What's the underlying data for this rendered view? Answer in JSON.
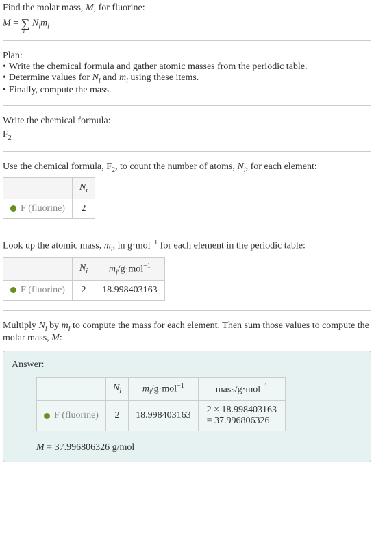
{
  "intro": {
    "line1_pre": "Find the molar mass, ",
    "line1_var": "M",
    "line1_post": ", for fluorine:",
    "formula_lhs": "M",
    "formula_eq": " = ",
    "formula_sum": "∑",
    "formula_sub": "i",
    "formula_n": "N",
    "formula_ni": "i",
    "formula_m": "m",
    "formula_mi": "i"
  },
  "plan": {
    "title": "Plan:",
    "items": [
      "Write the chemical formula and gather atomic masses from the periodic table.",
      "Determine values for N_i and m_i using these items.",
      "Finally, compute the mass."
    ],
    "item0": "Write the chemical formula and gather atomic masses from the periodic table.",
    "item1_pre": "Determine values for ",
    "item1_n": "N",
    "item1_ni": "i",
    "item1_mid": " and ",
    "item1_m": "m",
    "item1_mi": "i",
    "item1_post": " using these items.",
    "item2": "Finally, compute the mass."
  },
  "chemformula": {
    "title": "Write the chemical formula:",
    "element": "F",
    "sub": "2"
  },
  "count": {
    "text_pre": "Use the chemical formula, F",
    "text_sub": "2",
    "text_mid": ", to count the number of atoms, ",
    "text_n": "N",
    "text_ni": "i",
    "text_post": ", for each element:",
    "header_n": "N",
    "header_ni": "i",
    "element_f": "F",
    "element_name": " (fluorine)",
    "value": "2"
  },
  "lookup": {
    "text_pre": "Look up the atomic mass, ",
    "text_m": "m",
    "text_mi": "i",
    "text_mid": ", in g·mol",
    "text_sup": "−1",
    "text_post": " for each element in the periodic table:",
    "header_n": "N",
    "header_ni": "i",
    "header_m": "m",
    "header_mi": "i",
    "header_unit": "/g·mol",
    "header_sup": "−1",
    "element_f": "F",
    "element_name": " (fluorine)",
    "n_value": "2",
    "m_value": "18.998403163"
  },
  "multiply": {
    "text_pre": "Multiply ",
    "text_n": "N",
    "text_ni": "i",
    "text_mid": " by ",
    "text_m": "m",
    "text_mi": "i",
    "text_mid2": " to compute the mass for each element. Then sum those values to compute the molar mass, ",
    "text_M": "M",
    "text_post": ":"
  },
  "answer": {
    "label": "Answer:",
    "header_n": "N",
    "header_ni": "i",
    "header_m": "m",
    "header_mi": "i",
    "header_munit": "/g·mol",
    "header_msup": "−1",
    "header_mass": "mass/g·mol",
    "header_masssup": "−1",
    "element_f": "F",
    "element_name": " (fluorine)",
    "n_value": "2",
    "m_value": "18.998403163",
    "mass_line1": "2 × 18.998403163",
    "mass_line2": "= 37.996806326",
    "final_var": "M",
    "final_eq": " = 37.996806326 g/mol"
  },
  "chart_data": {
    "type": "table",
    "element": "F (fluorine)",
    "N_i": 2,
    "m_i_g_per_mol": 18.998403163,
    "mass_g_per_mol": 37.996806326,
    "molar_mass_g_per_mol": 37.996806326
  }
}
